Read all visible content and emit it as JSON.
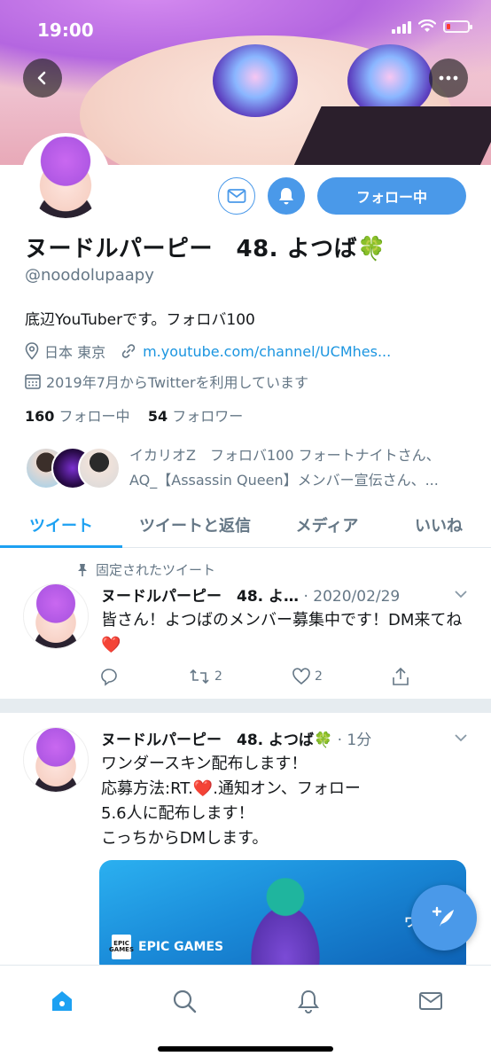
{
  "status_bar": {
    "time": "19:00"
  },
  "profile": {
    "display_name": "ヌードルパーピー　48. よつば🍀",
    "handle": "@noodolupaapy",
    "bio": "底辺YouTuberです。フォロバ100",
    "location": "日本 東京",
    "website": "m.youtube.com/channel/UCMhes...",
    "joined": "2019年7月からTwitterを利用しています",
    "following_count": "160",
    "following_label": "フォロー中",
    "followers_count": "54",
    "followers_label": "フォロワー",
    "followed_by_line1": "イカリオZ　フォロバ100 フォートナイトさん、",
    "followed_by_line2": "AQ_【Assassin Queen】メンバー宣伝さん、...",
    "follow_button": "フォロー中"
  },
  "tabs": [
    {
      "label": "ツイート",
      "active": true
    },
    {
      "label": "ツイートと返信",
      "active": false
    },
    {
      "label": "メディア",
      "active": false
    },
    {
      "label": "いいね",
      "active": false
    }
  ],
  "tweets": [
    {
      "pinned_label": "固定されたツイート",
      "name": "ヌードルパーピー　48. よ…",
      "meta": " · 2020/02/29",
      "body": "皆さん！よつばのメンバー募集中です！DM来てね❤️",
      "replies": "",
      "retweets": "2",
      "likes": "2"
    },
    {
      "name": "ヌードルパーピー　48. よつば🍀",
      "meta": " · 1分",
      "body_lines": [
        "ワンダースキン配布します！",
        "応募方法:RT.❤️.通知オン、フォロー",
        "5.6人に配布します！",
        "こっちからDMします。"
      ],
      "media": {
        "brand": "EPIC GAMES",
        "logo_text": "EPIC GAMES",
        "title": "ワンダー"
      }
    }
  ],
  "colors": {
    "accent": "#1da1f2",
    "button": "#4a99e9",
    "secondary_text": "#657786"
  },
  "icons": {
    "back": "chevron-left-icon",
    "more": "more-dots-icon",
    "mail": "mail-icon",
    "bell": "bell-icon",
    "pin": "pin-icon",
    "home": "home-icon",
    "search": "search-icon",
    "notifications": "bell-icon",
    "messages": "mail-icon",
    "compose": "compose-icon"
  }
}
